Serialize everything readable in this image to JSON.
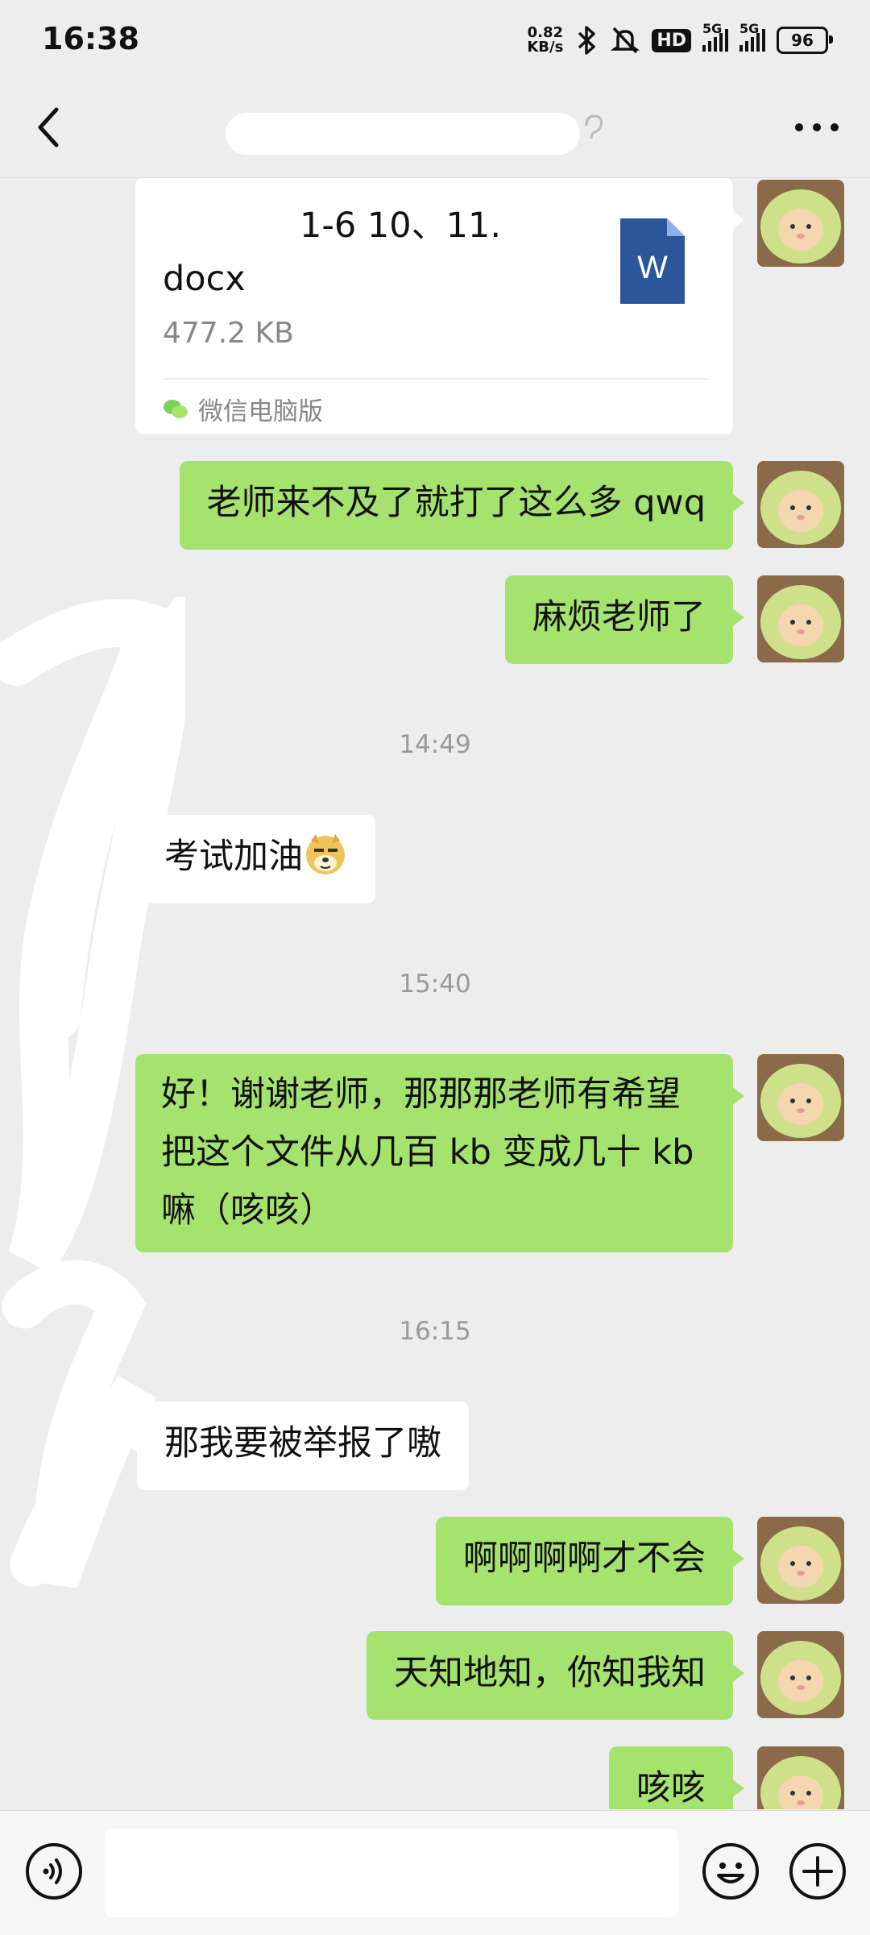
{
  "status_bar": {
    "time": "16:38",
    "net_speed_value": "0.82",
    "net_speed_unit": "KB/s",
    "hd_label": "HD",
    "sim1_label": "5G",
    "sim2_label": "5G",
    "battery_level": "96",
    "icons": [
      "bluetooth-icon",
      "mute-icon",
      "hd-icon",
      "signal-icon",
      "signal-icon",
      "battery-icon"
    ]
  },
  "nav": {
    "title": "",
    "back_icon": "chevron-left-icon",
    "more_icon": "more-icon"
  },
  "colors": {
    "background": "#ededed",
    "my_bubble": "#a6e36e",
    "other_bubble": "#ffffff",
    "timestamp": "#9a9a9a",
    "word_blue": "#2b579a"
  },
  "messages": {
    "file": {
      "name_line1": "1-6 10、11.",
      "name_line2": "docx",
      "size": "477.2 KB",
      "source": "微信电脑版",
      "icon": "word-file-icon",
      "sender": "me"
    },
    "m1": {
      "text": "老师来不及了就打了这么多 qwq",
      "sender": "me"
    },
    "m2": {
      "text": "麻烦老师了",
      "sender": "me"
    },
    "t1": "14:49",
    "m3": {
      "text": "考试加油",
      "emoji": "doge-emoji",
      "sender": "other"
    },
    "t2": "15:40",
    "m4": {
      "line1": "好！谢谢老师，那那那老师有希望",
      "line2": "把这个文件从几百 kb 变成几十 kb",
      "line3": "嘛（咳咳）",
      "sender": "me"
    },
    "t3": "16:15",
    "m5": {
      "text": "那我要被举报了嗷",
      "sender": "other"
    },
    "m6": {
      "text": "啊啊啊啊才不会",
      "sender": "me"
    },
    "m7": {
      "text": "天知地知，你知我知",
      "sender": "me"
    },
    "m8": {
      "text": "咳咳",
      "sender": "me"
    }
  },
  "input_bar": {
    "voice_icon": "voice-icon",
    "text_value": "",
    "emoji_icon": "emoji-icon",
    "plus_icon": "plus-icon"
  }
}
